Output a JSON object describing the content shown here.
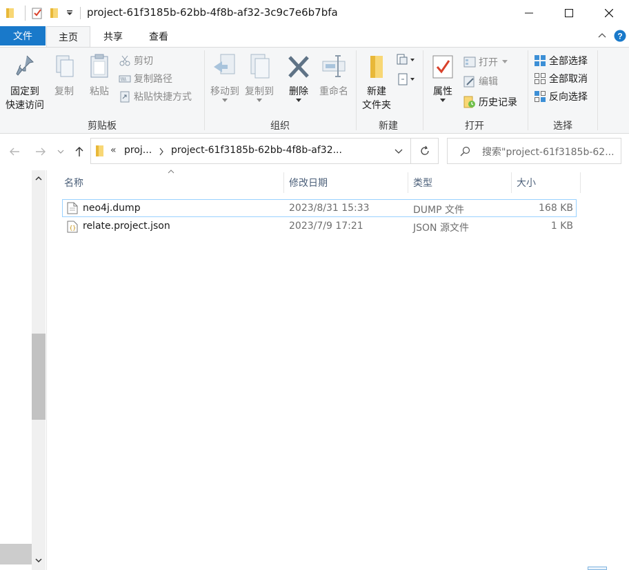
{
  "window": {
    "title": "project-61f3185b-62bb-4f8b-af32-3c9c7e6b7bfa",
    "controls": [
      "minimize-icon",
      "maximize-icon",
      "close-icon"
    ]
  },
  "ribbon_tabs": {
    "file": "文件",
    "home": "主页",
    "share": "共享",
    "view": "查看"
  },
  "ribbon": {
    "clipboard": {
      "label": "剪贴板",
      "pin": "固定到\n快速访问",
      "pin_line1": "固定到",
      "pin_line2": "快速访问",
      "copy": "复制",
      "paste": "粘贴",
      "cut": "剪切",
      "copy_path": "复制路径",
      "paste_shortcut": "粘贴快捷方式"
    },
    "organize": {
      "label": "组织",
      "move_to": "移动到",
      "copy_to": "复制到",
      "delete": "删除",
      "rename": "重命名"
    },
    "new": {
      "label": "新建",
      "new_folder_line1": "新建",
      "new_folder_line2": "文件夹"
    },
    "open": {
      "label": "打开",
      "properties": "属性",
      "open": "打开",
      "edit": "编辑",
      "history": "历史记录"
    },
    "select": {
      "label": "选择",
      "select_all": "全部选择",
      "select_none": "全部取消",
      "invert": "反向选择"
    }
  },
  "address": {
    "crumb_overflow": "«",
    "crumb_parent": "proj...",
    "crumb_current": "project-61f3185b-62bb-4f8b-af32...",
    "search_placeholder": "搜索\"project-61f3185b-62..."
  },
  "columns": {
    "name": "名称",
    "modified": "修改日期",
    "type": "类型",
    "size": "大小"
  },
  "files": [
    {
      "name": "neo4j.dump",
      "modified": "2023/8/31 15:33",
      "type": "DUMP 文件",
      "size": "168 KB",
      "icon": "file-icon"
    },
    {
      "name": "relate.project.json",
      "modified": "2023/7/9 17:21",
      "type": "JSON 源文件",
      "size": "1 KB",
      "icon": "json-file-icon"
    }
  ],
  "colors": {
    "accent": "#1979ca",
    "ribbon_bg": "#f5f6f7",
    "selection_border": "#99d1ff",
    "header_text": "#4c607a"
  }
}
